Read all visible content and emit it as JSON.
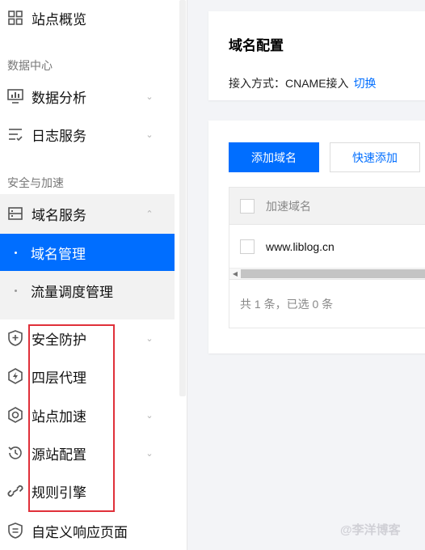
{
  "sidebar": {
    "overview": "站点概览",
    "group_data": "数据中心",
    "analytics": "数据分析",
    "logs": "日志服务",
    "group_security": "安全与加速",
    "domain_service": "域名服务",
    "domain_manage": "域名管理",
    "traffic_schedule": "流量调度管理",
    "security_protect": "安全防护",
    "l4_proxy": "四层代理",
    "site_accel": "站点加速",
    "origin_config": "源站配置",
    "rule_engine": "规则引擎",
    "custom_page": "自定义响应页面"
  },
  "config_card": {
    "title": "域名配置",
    "access_label": "接入方式：CNAME接入",
    "switch_link": "切换"
  },
  "domain_card": {
    "add_button": "添加域名",
    "quick_add_button": "快速添加",
    "table": {
      "header": "加速域名",
      "rows": [
        {
          "domain": "www.liblog.cn"
        }
      ],
      "footer": "共 1 条，已选 0 条"
    }
  },
  "watermark": "@李洋博客",
  "colors": {
    "accent": "#006eff",
    "highlight_box": "#e0303a"
  }
}
